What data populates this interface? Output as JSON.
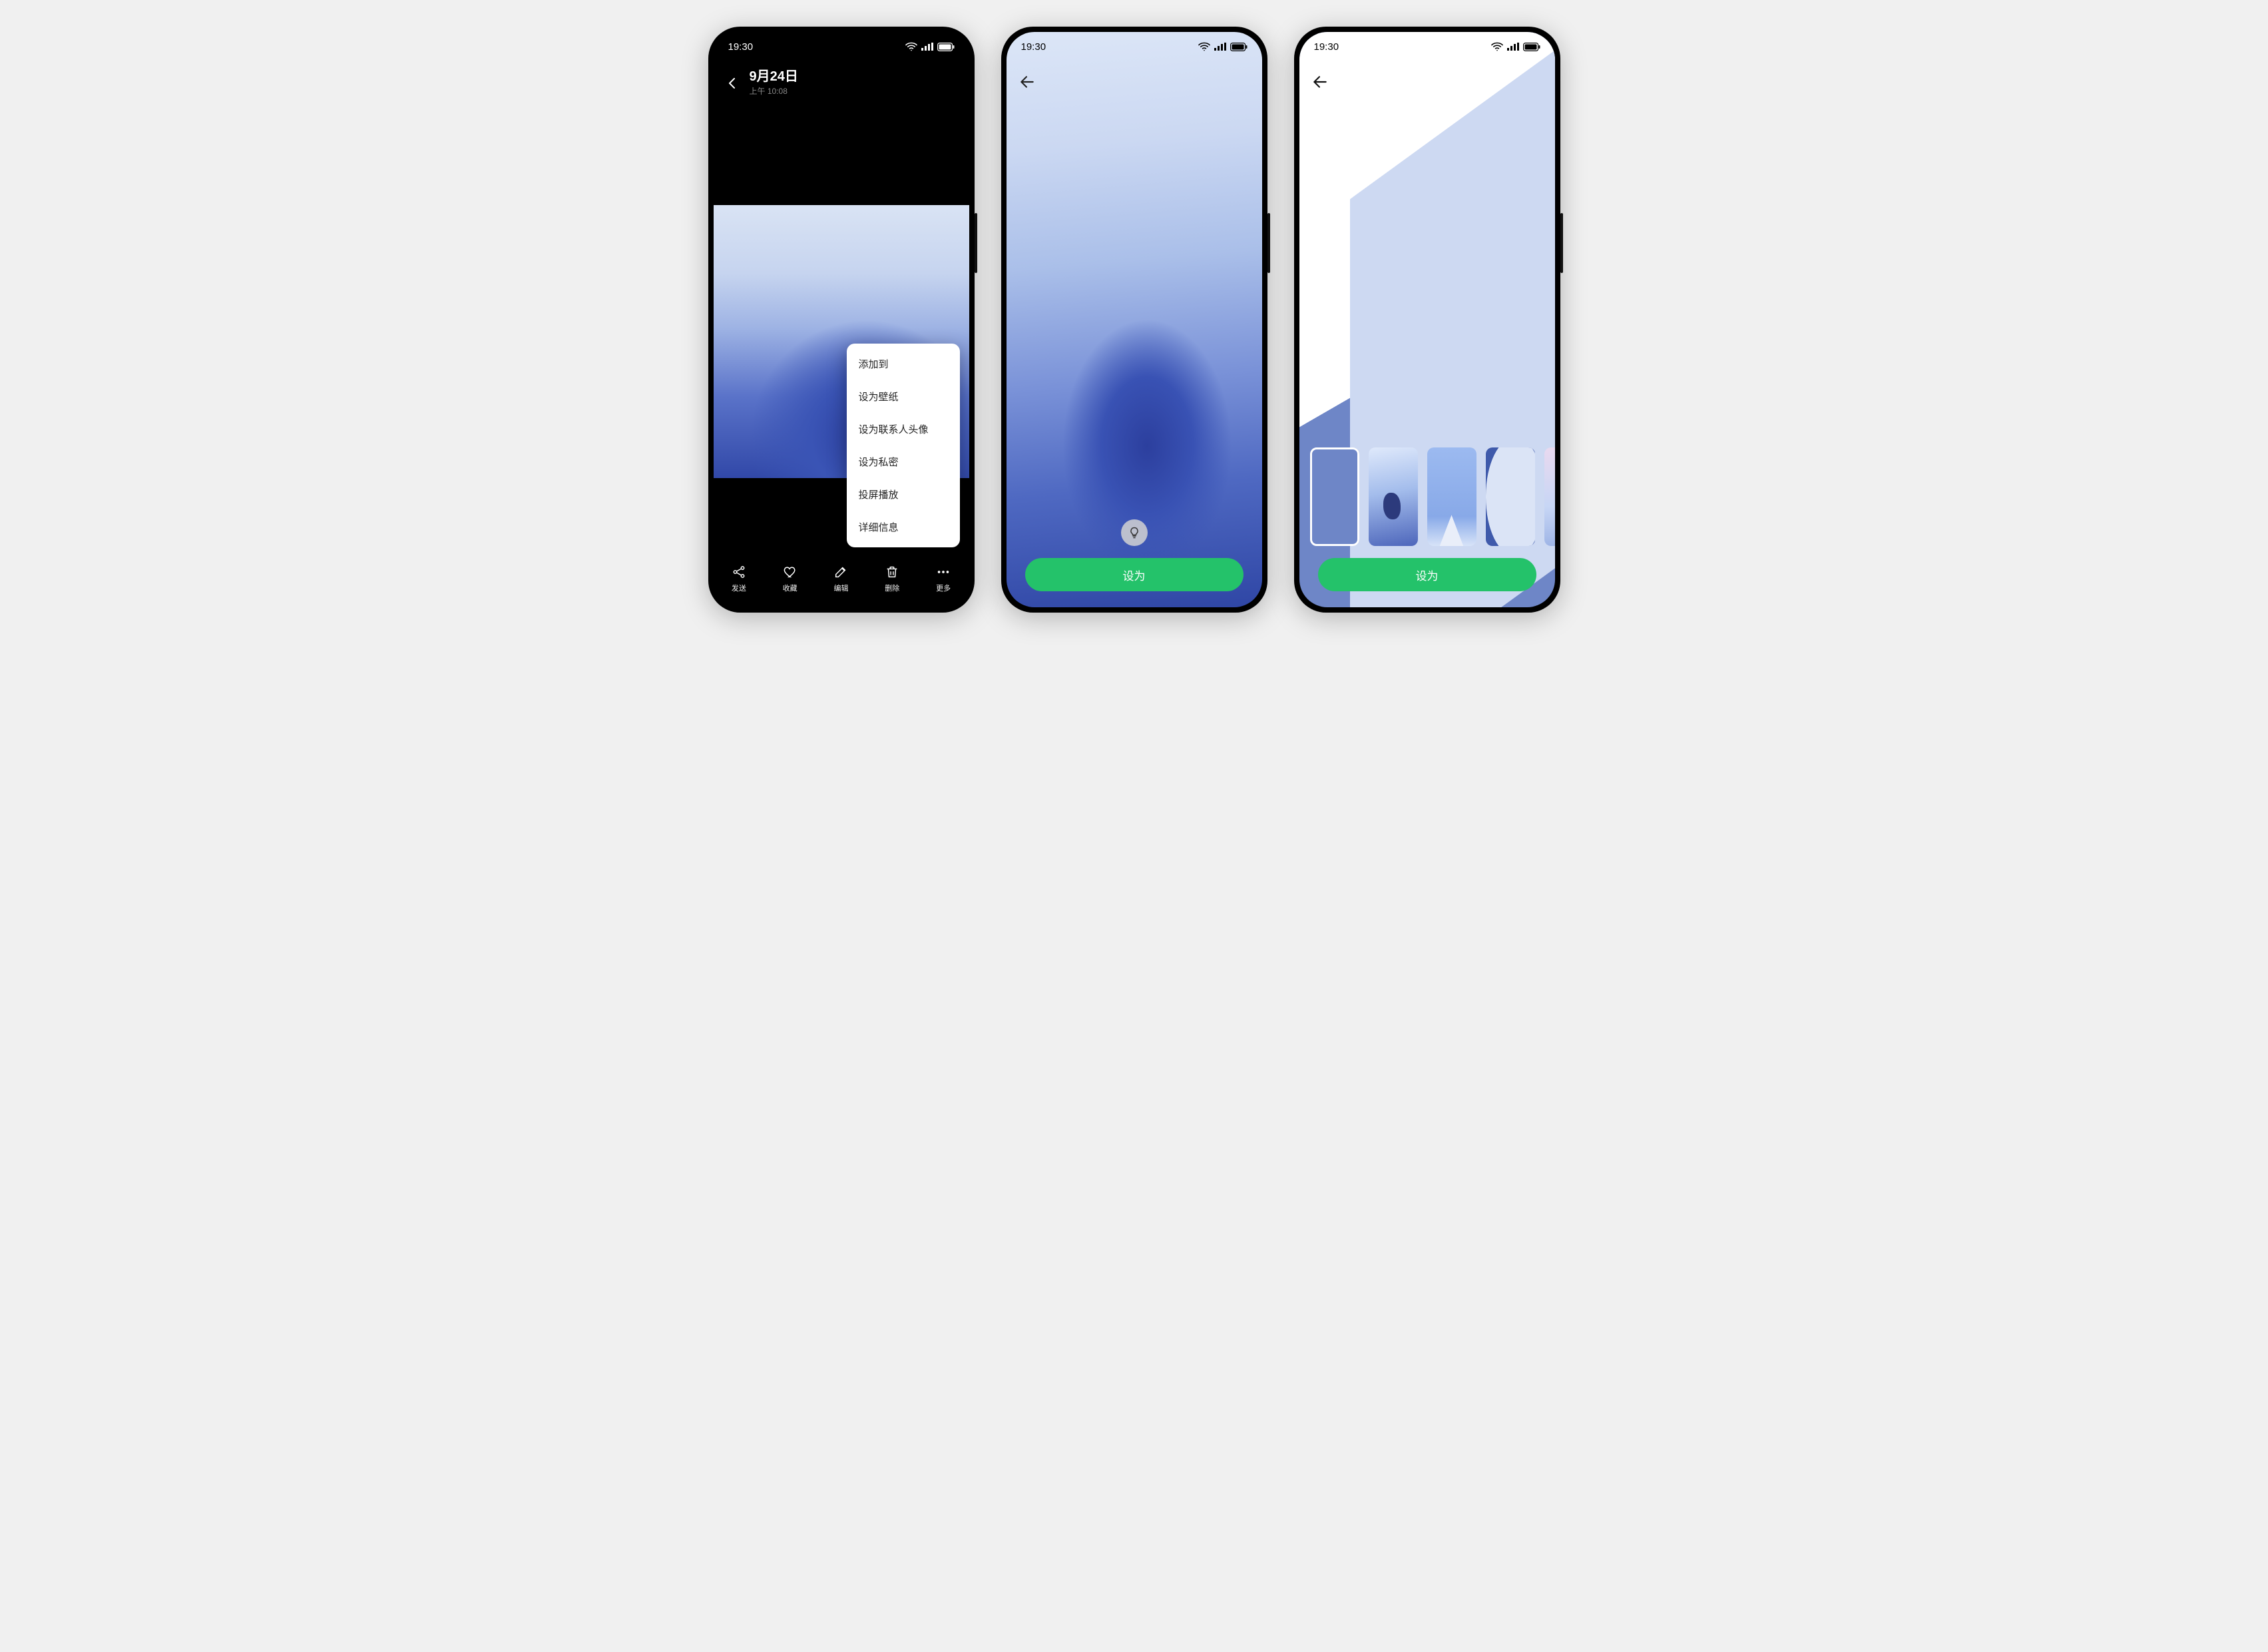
{
  "status": {
    "time": "19:30"
  },
  "screen1": {
    "title": "9月24日",
    "subtitle": "上午 10:08",
    "menu": [
      "添加到",
      "设为壁纸",
      "设为联系人头像",
      "设为私密",
      "投屏播放",
      "详细信息"
    ],
    "bottombar": {
      "send": "发送",
      "fav": "收藏",
      "edit": "编辑",
      "delete": "删除",
      "more": "更多"
    }
  },
  "screen2": {
    "apply": "设为"
  },
  "screen3": {
    "apply": "设为"
  }
}
